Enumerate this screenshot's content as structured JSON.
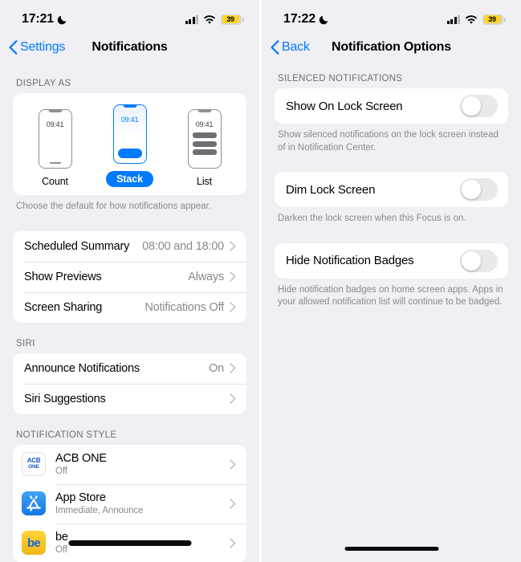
{
  "left": {
    "status_bar": {
      "time": "17:21",
      "moon_icon": "crescent-moon-icon",
      "signal_icon": "cellular-signal-icon",
      "wifi_icon": "wifi-icon",
      "battery_level": "39",
      "battery_color": "#FFD426"
    },
    "nav": {
      "back_label": "Settings",
      "title": "Notifications"
    },
    "display_as": {
      "header": "DISPLAY AS",
      "options": [
        {
          "label": "Count",
          "time": "09:41",
          "selected": false
        },
        {
          "label": "Stack",
          "time": "09:41",
          "selected": true
        },
        {
          "label": "List",
          "time": "09:41",
          "selected": false
        }
      ],
      "footnote": "Choose the default for how notifications appear."
    },
    "general_rows": [
      {
        "title": "Scheduled Summary",
        "value": "08:00 and 18:00"
      },
      {
        "title": "Show Previews",
        "value": "Always"
      },
      {
        "title": "Screen Sharing",
        "value": "Notifications Off"
      }
    ],
    "siri": {
      "header": "SIRI",
      "rows": [
        {
          "title": "Announce Notifications",
          "value": "On"
        },
        {
          "title": "Siri Suggestions",
          "value": ""
        }
      ]
    },
    "notification_style": {
      "header": "NOTIFICATION STYLE",
      "apps": [
        {
          "name": "ACB ONE",
          "status": "Off",
          "icon": "acb-one-app-icon",
          "icon_line1": "ACB",
          "icon_line2": "ONE"
        },
        {
          "name": "App Store",
          "status": "Immediate, Announce",
          "icon": "app-store-app-icon"
        },
        {
          "name": "be",
          "status": "Off",
          "icon": "be-app-icon",
          "icon_text": "be"
        }
      ]
    }
  },
  "right": {
    "status_bar": {
      "time": "17:22",
      "moon_icon": "crescent-moon-icon",
      "signal_icon": "cellular-signal-icon",
      "wifi_icon": "wifi-icon",
      "battery_level": "39",
      "battery_color": "#FFD426"
    },
    "nav": {
      "back_label": "Back",
      "title": "Notification Options"
    },
    "section_header": "SILENCED NOTIFICATIONS",
    "settings": [
      {
        "title": "Show On Lock Screen",
        "toggle_on": false,
        "footnote": "Show silenced notifications on the lock screen instead of in Notification Center."
      },
      {
        "title": "Dim Lock Screen",
        "toggle_on": false,
        "footnote": "Darken the lock screen when this Focus is on."
      },
      {
        "title": "Hide Notification Badges",
        "toggle_on": false,
        "footnote": "Hide notification badges on home screen apps. Apps in your allowed notification list will continue to be badged."
      }
    ]
  },
  "accent_color": "#007AFF"
}
